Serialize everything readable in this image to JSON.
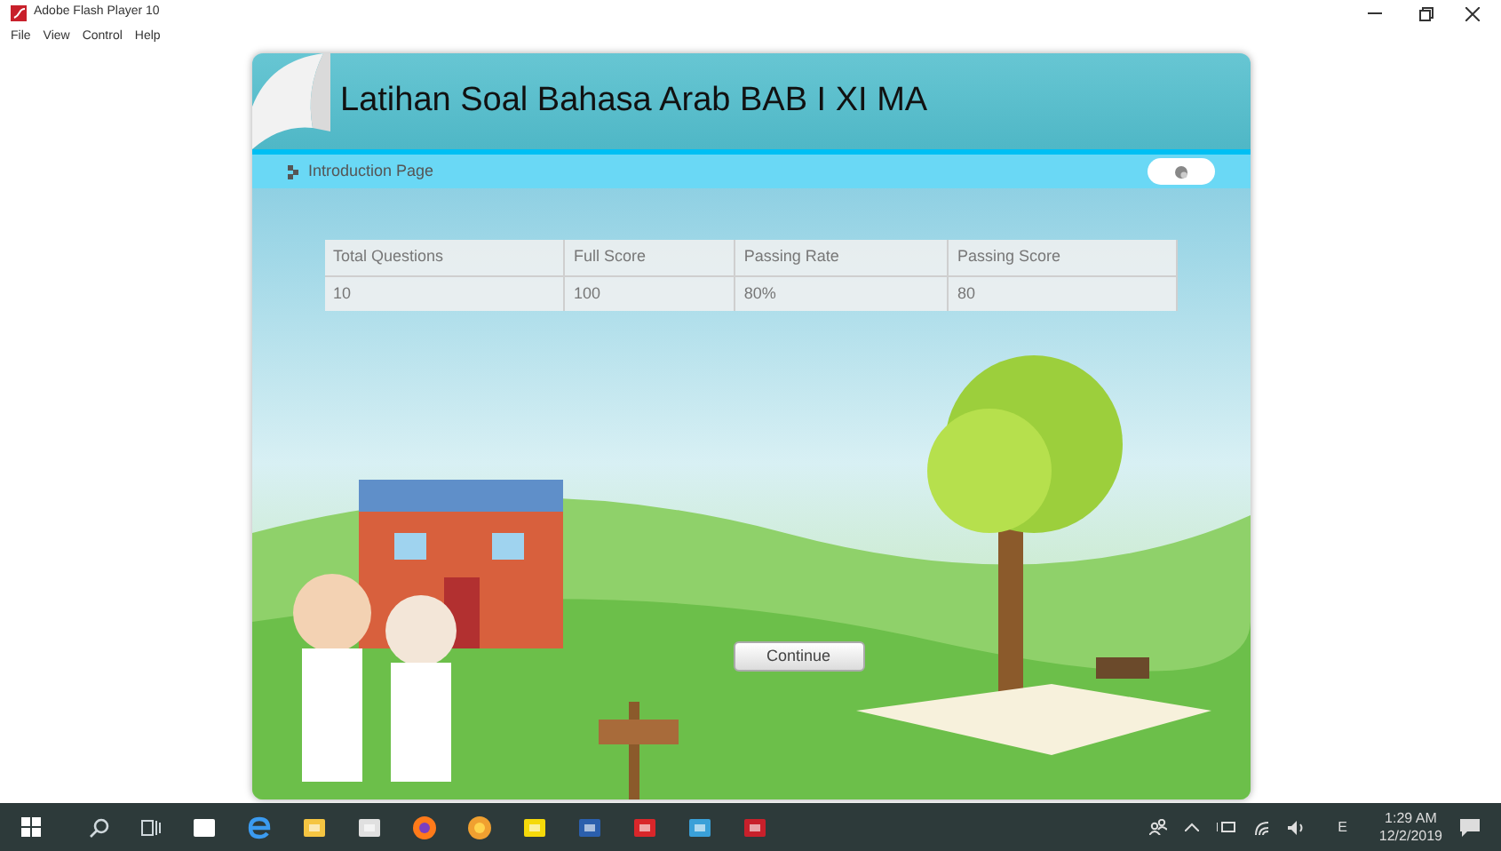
{
  "window": {
    "title": "Adobe Flash Player 10",
    "menu": [
      "File",
      "View",
      "Control",
      "Help"
    ]
  },
  "quiz": {
    "title": "Latihan Soal Bahasa Arab BAB I XI MA",
    "breadcrumb": "Introduction Page",
    "table": {
      "columns": [
        "Total Questions",
        "Full Score",
        "Passing Rate",
        "Passing Score"
      ],
      "rows": [
        [
          "10",
          "100",
          "80%",
          "80"
        ]
      ]
    },
    "continue_button": "Continue"
  },
  "taskbar": {
    "language": "E",
    "time": "1:29 AM",
    "date": "12/2/2019"
  }
}
